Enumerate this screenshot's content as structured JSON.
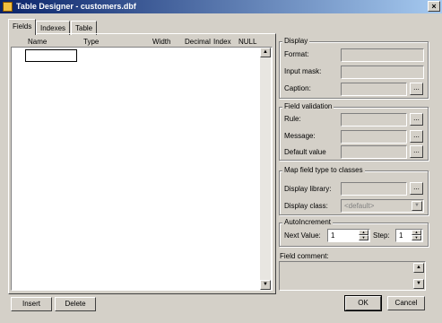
{
  "window": {
    "title": "Table Designer - customers.dbf",
    "close_glyph": "×"
  },
  "tabs": [
    "Fields",
    "Indexes",
    "Table"
  ],
  "columns": [
    "Name",
    "Type",
    "Width",
    "Decimal",
    "Index",
    "NULL"
  ],
  "display_group": {
    "title": "Display",
    "format_label": "Format:",
    "input_mask_label": "Input mask:",
    "caption_label": "Caption:"
  },
  "validation_group": {
    "title": "Field validation",
    "rule_label": "Rule:",
    "message_label": "Message:",
    "default_label": "Default value"
  },
  "map_group": {
    "title": "Map field type to classes",
    "library_label": "Display library:",
    "class_label": "Display class:",
    "class_value": "<default>"
  },
  "auto_group": {
    "title": "AutoIncrement",
    "next_label": "Next Value:",
    "next_value": "1",
    "step_label": "Step:",
    "step_value": "1"
  },
  "comment": {
    "label": "Field comment:"
  },
  "buttons": {
    "insert": "Insert",
    "delete": "Delete",
    "ok": "OK",
    "cancel": "Cancel",
    "dots": "..."
  }
}
